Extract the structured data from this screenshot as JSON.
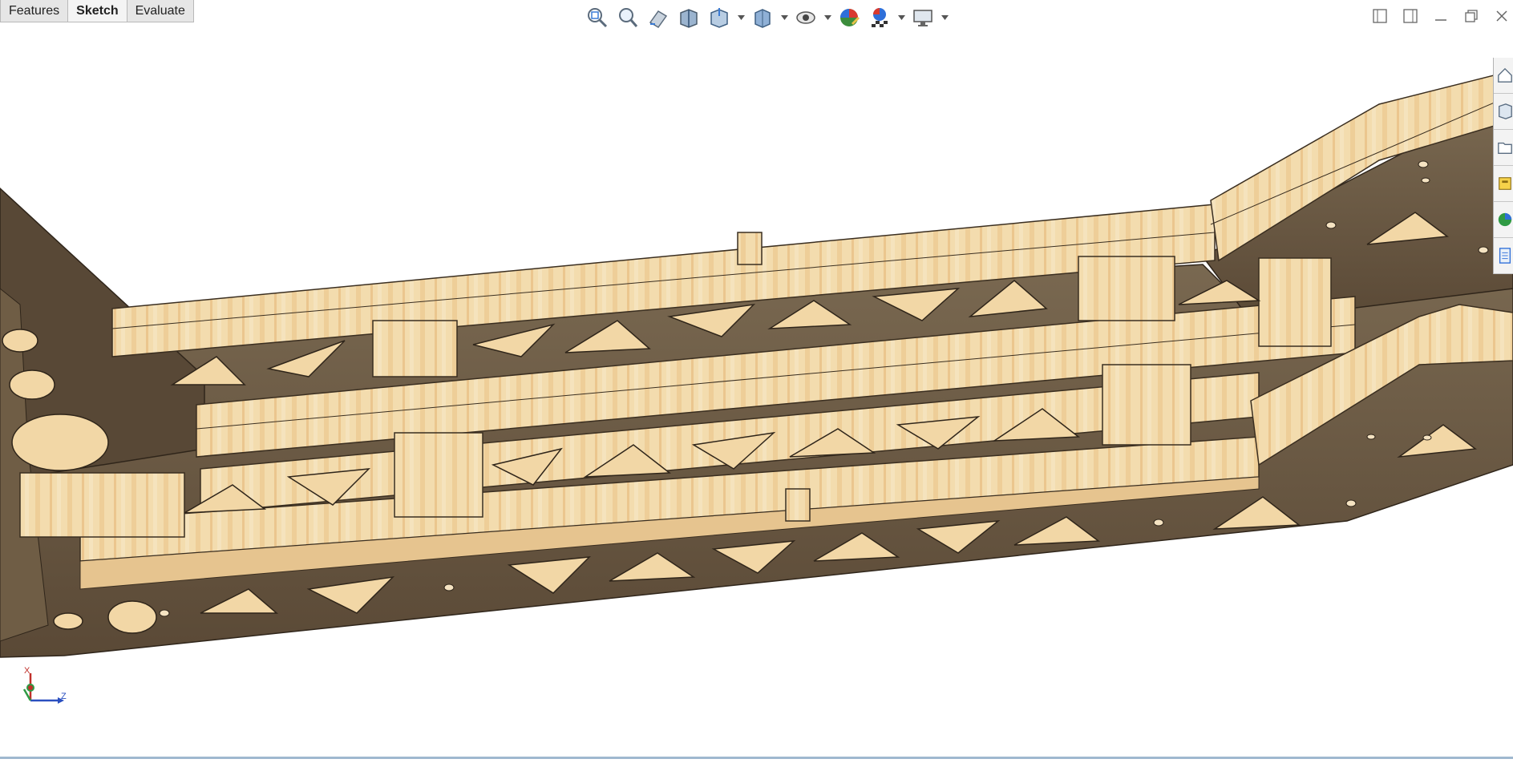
{
  "tabs": [
    {
      "label": "Features",
      "active": false
    },
    {
      "label": "Sketch",
      "active": true
    },
    {
      "label": "Evaluate",
      "active": false
    }
  ],
  "hud_icons": [
    "zoom-to-fit-icon",
    "zoom-to-area-icon",
    "previous-view-icon",
    "section-view-icon",
    "view-orientation-icon",
    "display-style-icon",
    "hide-show-items-icon",
    "edit-appearance-icon",
    "apply-scene-icon",
    "view-settings-icon"
  ],
  "window_controls": [
    "tile-left-icon",
    "tile-right-icon",
    "minimize-icon",
    "restore-icon",
    "close-icon"
  ],
  "task_pane": [
    "home-icon",
    "design-library-icon",
    "file-explorer-icon",
    "view-palette-icon",
    "appearances-icon",
    "custom-properties-icon"
  ],
  "triad": {
    "x_label": "X",
    "z_label": "Z"
  },
  "colors": {
    "wood_light": "#f2d9a8",
    "wood_grain": "#e8b779",
    "plate_dark": "#6b5942",
    "plate_edge": "#3e3122",
    "background": "#ffffff"
  }
}
